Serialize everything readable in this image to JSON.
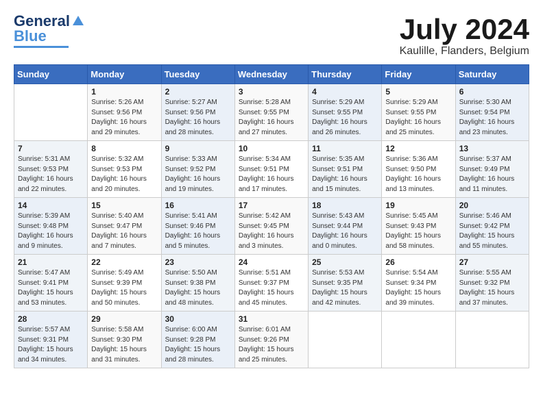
{
  "header": {
    "logo_general": "General",
    "logo_blue": "Blue",
    "title": "July 2024",
    "subtitle": "Kaulille, Flanders, Belgium"
  },
  "days_of_week": [
    "Sunday",
    "Monday",
    "Tuesday",
    "Wednesday",
    "Thursday",
    "Friday",
    "Saturday"
  ],
  "weeks": [
    [
      {
        "day": "",
        "info": ""
      },
      {
        "day": "1",
        "info": "Sunrise: 5:26 AM\nSunset: 9:56 PM\nDaylight: 16 hours\nand 29 minutes."
      },
      {
        "day": "2",
        "info": "Sunrise: 5:27 AM\nSunset: 9:56 PM\nDaylight: 16 hours\nand 28 minutes."
      },
      {
        "day": "3",
        "info": "Sunrise: 5:28 AM\nSunset: 9:55 PM\nDaylight: 16 hours\nand 27 minutes."
      },
      {
        "day": "4",
        "info": "Sunrise: 5:29 AM\nSunset: 9:55 PM\nDaylight: 16 hours\nand 26 minutes."
      },
      {
        "day": "5",
        "info": "Sunrise: 5:29 AM\nSunset: 9:55 PM\nDaylight: 16 hours\nand 25 minutes."
      },
      {
        "day": "6",
        "info": "Sunrise: 5:30 AM\nSunset: 9:54 PM\nDaylight: 16 hours\nand 23 minutes."
      }
    ],
    [
      {
        "day": "7",
        "info": "Sunrise: 5:31 AM\nSunset: 9:53 PM\nDaylight: 16 hours\nand 22 minutes."
      },
      {
        "day": "8",
        "info": "Sunrise: 5:32 AM\nSunset: 9:53 PM\nDaylight: 16 hours\nand 20 minutes."
      },
      {
        "day": "9",
        "info": "Sunrise: 5:33 AM\nSunset: 9:52 PM\nDaylight: 16 hours\nand 19 minutes."
      },
      {
        "day": "10",
        "info": "Sunrise: 5:34 AM\nSunset: 9:51 PM\nDaylight: 16 hours\nand 17 minutes."
      },
      {
        "day": "11",
        "info": "Sunrise: 5:35 AM\nSunset: 9:51 PM\nDaylight: 16 hours\nand 15 minutes."
      },
      {
        "day": "12",
        "info": "Sunrise: 5:36 AM\nSunset: 9:50 PM\nDaylight: 16 hours\nand 13 minutes."
      },
      {
        "day": "13",
        "info": "Sunrise: 5:37 AM\nSunset: 9:49 PM\nDaylight: 16 hours\nand 11 minutes."
      }
    ],
    [
      {
        "day": "14",
        "info": "Sunrise: 5:39 AM\nSunset: 9:48 PM\nDaylight: 16 hours\nand 9 minutes."
      },
      {
        "day": "15",
        "info": "Sunrise: 5:40 AM\nSunset: 9:47 PM\nDaylight: 16 hours\nand 7 minutes."
      },
      {
        "day": "16",
        "info": "Sunrise: 5:41 AM\nSunset: 9:46 PM\nDaylight: 16 hours\nand 5 minutes."
      },
      {
        "day": "17",
        "info": "Sunrise: 5:42 AM\nSunset: 9:45 PM\nDaylight: 16 hours\nand 3 minutes."
      },
      {
        "day": "18",
        "info": "Sunrise: 5:43 AM\nSunset: 9:44 PM\nDaylight: 16 hours\nand 0 minutes."
      },
      {
        "day": "19",
        "info": "Sunrise: 5:45 AM\nSunset: 9:43 PM\nDaylight: 15 hours\nand 58 minutes."
      },
      {
        "day": "20",
        "info": "Sunrise: 5:46 AM\nSunset: 9:42 PM\nDaylight: 15 hours\nand 55 minutes."
      }
    ],
    [
      {
        "day": "21",
        "info": "Sunrise: 5:47 AM\nSunset: 9:41 PM\nDaylight: 15 hours\nand 53 minutes."
      },
      {
        "day": "22",
        "info": "Sunrise: 5:49 AM\nSunset: 9:39 PM\nDaylight: 15 hours\nand 50 minutes."
      },
      {
        "day": "23",
        "info": "Sunrise: 5:50 AM\nSunset: 9:38 PM\nDaylight: 15 hours\nand 48 minutes."
      },
      {
        "day": "24",
        "info": "Sunrise: 5:51 AM\nSunset: 9:37 PM\nDaylight: 15 hours\nand 45 minutes."
      },
      {
        "day": "25",
        "info": "Sunrise: 5:53 AM\nSunset: 9:35 PM\nDaylight: 15 hours\nand 42 minutes."
      },
      {
        "day": "26",
        "info": "Sunrise: 5:54 AM\nSunset: 9:34 PM\nDaylight: 15 hours\nand 39 minutes."
      },
      {
        "day": "27",
        "info": "Sunrise: 5:55 AM\nSunset: 9:32 PM\nDaylight: 15 hours\nand 37 minutes."
      }
    ],
    [
      {
        "day": "28",
        "info": "Sunrise: 5:57 AM\nSunset: 9:31 PM\nDaylight: 15 hours\nand 34 minutes."
      },
      {
        "day": "29",
        "info": "Sunrise: 5:58 AM\nSunset: 9:30 PM\nDaylight: 15 hours\nand 31 minutes."
      },
      {
        "day": "30",
        "info": "Sunrise: 6:00 AM\nSunset: 9:28 PM\nDaylight: 15 hours\nand 28 minutes."
      },
      {
        "day": "31",
        "info": "Sunrise: 6:01 AM\nSunset: 9:26 PM\nDaylight: 15 hours\nand 25 minutes."
      },
      {
        "day": "",
        "info": ""
      },
      {
        "day": "",
        "info": ""
      },
      {
        "day": "",
        "info": ""
      }
    ]
  ]
}
